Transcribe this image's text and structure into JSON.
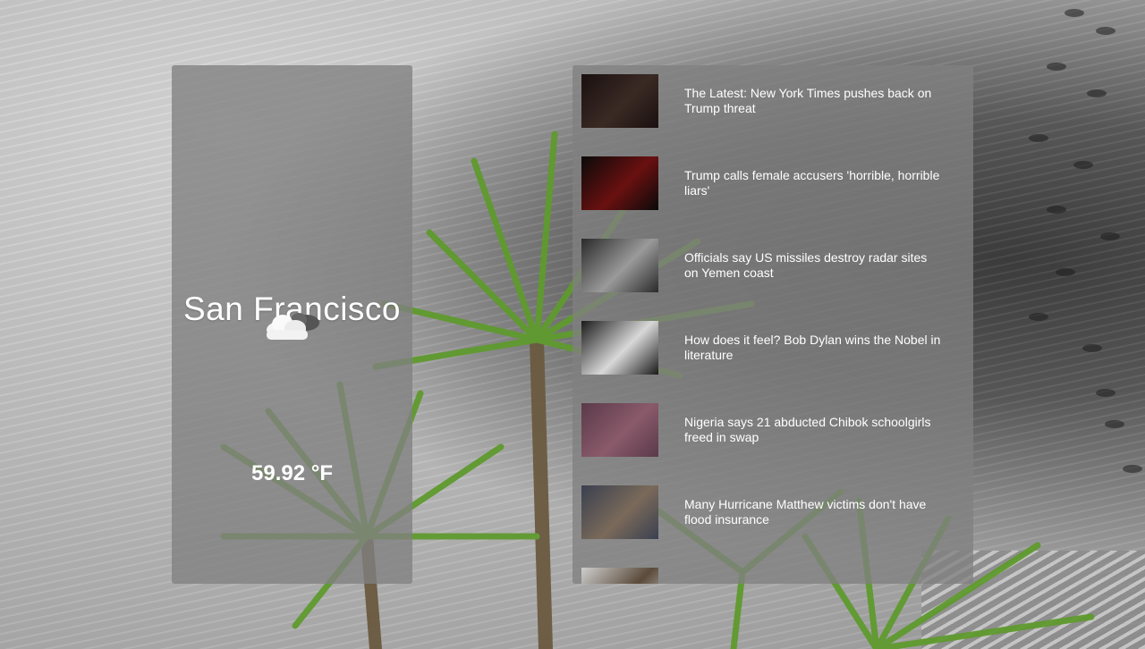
{
  "weather": {
    "city": "San Francisco",
    "icon": "partly-cloudy-icon",
    "temperature": "59.92 °F"
  },
  "news": {
    "items": [
      {
        "headline": "The Latest: New York Times pushes back on Trump threat",
        "thumb_colors": [
          "#1a1010",
          "#3a2a24"
        ]
      },
      {
        "headline": "Trump calls female accusers 'horrible, horrible liars'",
        "thumb_colors": [
          "#0a0a0a",
          "#6a1010"
        ]
      },
      {
        "headline": "Officials say US missiles destroy radar sites on Yemen coast",
        "thumb_colors": [
          "#2a2a2a",
          "#9a9a9a"
        ]
      },
      {
        "headline": "How does it feel? Bob Dylan wins the Nobel in literature",
        "thumb_colors": [
          "#1a1a1a",
          "#d8d8d8"
        ]
      },
      {
        "headline": "Nigeria says 21 abducted Chibok schoolgirls freed in swap",
        "thumb_colors": [
          "#5a3a4a",
          "#8a5a6a"
        ]
      },
      {
        "headline": "Many Hurricane Matthew victims don't have flood insurance",
        "thumb_colors": [
          "#3a4050",
          "#7a6a5a"
        ]
      },
      {
        "headline": "",
        "thumb_colors": [
          "#cfcfcf",
          "#5a4a3a"
        ]
      }
    ]
  }
}
